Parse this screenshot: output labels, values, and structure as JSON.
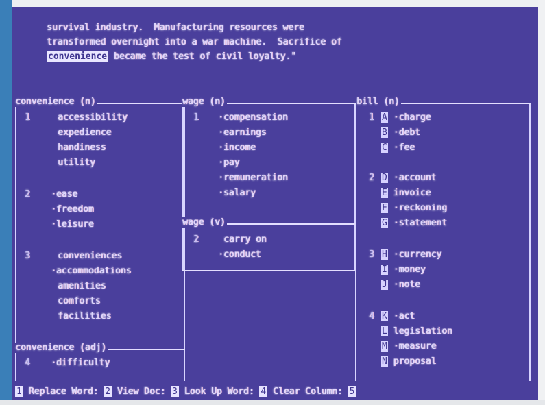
{
  "document": {
    "line1": "survival industry.  Manufacturing resources were",
    "line2": "transformed overnight into a war machine.  Sacrifice of",
    "highlight": "convenience",
    "line3_rest": " became the test of civil loyalty.\""
  },
  "columns": [
    {
      "sections": [
        {
          "header": "convenience (n)",
          "groups": [
            {
              "number": "1",
              "words": [
                "accessibility",
                "expedience",
                "handiness",
                "utility"
              ]
            },
            {
              "number": "2",
              "words": [
                "·ease",
                "·freedom",
                "·leisure"
              ]
            },
            {
              "number": "3",
              "words": [
                "conveniences",
                "·accommodations",
                "amenities",
                "comforts",
                "facilities"
              ]
            }
          ]
        },
        {
          "header": "convenience (adj)",
          "groups": [
            {
              "number": "4",
              "words": [
                "·difficulty"
              ]
            }
          ]
        }
      ]
    },
    {
      "sections": [
        {
          "header": "wage (n)",
          "groups": [
            {
              "number": "1",
              "words": [
                "·compensation",
                "·earnings",
                "·income",
                "·pay",
                "·remuneration",
                "·salary"
              ]
            }
          ]
        },
        {
          "header": "wage (v)",
          "groups": [
            {
              "number": "2",
              "words": [
                "carry on",
                "·conduct"
              ]
            }
          ]
        }
      ]
    },
    {
      "sections": [
        {
          "header": "bill (n)",
          "groups": [
            {
              "number": "1",
              "items": [
                {
                  "letter": "A",
                  "word": "·charge"
                },
                {
                  "letter": "B",
                  "word": "·debt"
                },
                {
                  "letter": "C",
                  "word": "·fee"
                }
              ]
            },
            {
              "number": "2",
              "items": [
                {
                  "letter": "D",
                  "word": "·account"
                },
                {
                  "letter": "E",
                  "word": "invoice"
                },
                {
                  "letter": "F",
                  "word": "·reckoning"
                },
                {
                  "letter": "G",
                  "word": "·statement"
                }
              ]
            },
            {
              "number": "3",
              "items": [
                {
                  "letter": "H",
                  "word": "·currency"
                },
                {
                  "letter": "I",
                  "word": "·money"
                },
                {
                  "letter": "J",
                  "word": "·note"
                }
              ]
            },
            {
              "number": "4",
              "items": [
                {
                  "letter": "K",
                  "word": "·act"
                },
                {
                  "letter": "L",
                  "word": "legislation"
                },
                {
                  "letter": "M",
                  "word": "·measure"
                },
                {
                  "letter": "N",
                  "word": "proposal"
                }
              ]
            }
          ]
        }
      ]
    }
  ],
  "function_bar": {
    "keys": [
      {
        "num": "1",
        "label": "Replace Word"
      },
      {
        "num": "2",
        "label": "View Doc"
      },
      {
        "num": "3",
        "label": "Look Up Word"
      },
      {
        "num": "4",
        "label": "Clear Column"
      },
      {
        "num": "5",
        "label": ""
      }
    ]
  },
  "colors": {
    "screen": "#4a3f9c",
    "text": "#c9c6f3",
    "highlight_bg": "#e9e6ff",
    "bezel_left": "#3a7fb8"
  }
}
